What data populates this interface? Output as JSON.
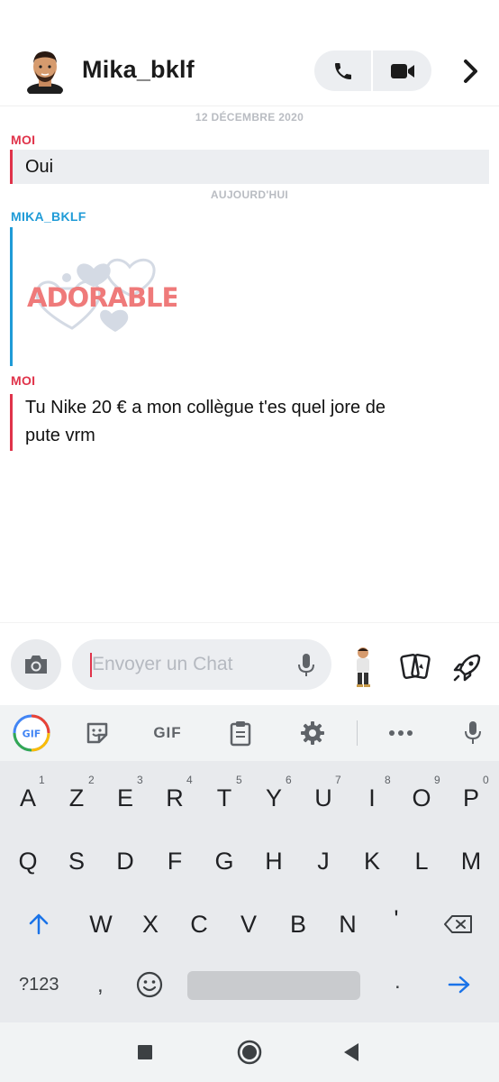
{
  "header": {
    "contact_name": "Mika_bklf",
    "avatar_icon": "bitmoji-avatar",
    "call_icon": "phone-icon",
    "video_icon": "video-camera-icon",
    "more_icon": "chevron-right-icon"
  },
  "conversation": {
    "date_1": "12 DÉCEMBRE 2020",
    "date_2": "AUJOURD'HUI",
    "messages": [
      {
        "sender": "MOI",
        "text": "Oui"
      },
      {
        "sender": "MIKA_BKLF",
        "sticker_text": "ADORABLE"
      },
      {
        "sender": "MOI",
        "text_line1": "Tu Nike 20 € a mon collègue t'es quel jore de",
        "text_line2": "pute vrm"
      }
    ],
    "colors": {
      "me": "#e0334a",
      "other": "#1f9bd7",
      "sticker": "#ef7a7a"
    }
  },
  "input_bar": {
    "placeholder": "Envoyer un Chat",
    "camera_icon": "camera-icon",
    "mic_icon": "microphone-icon",
    "bitmoji_icon": "bitmoji-icon",
    "cards_icon": "cards-icon",
    "rocket_icon": "rocket-icon"
  },
  "keyboard": {
    "toolbar": [
      "gif-search-icon",
      "sticker-icon",
      "GIF",
      "clipboard-icon",
      "gear-icon",
      "more-icon",
      "microphone-icon"
    ],
    "gif_label": "GIF",
    "gif_badge": "GIF",
    "row1": [
      "A",
      "Z",
      "E",
      "R",
      "T",
      "Y",
      "U",
      "I",
      "O",
      "P"
    ],
    "row1_hints": [
      "1",
      "2",
      "3",
      "4",
      "5",
      "6",
      "7",
      "8",
      "9",
      "0"
    ],
    "row2": [
      "Q",
      "S",
      "D",
      "F",
      "G",
      "H",
      "J",
      "K",
      "L",
      "M"
    ],
    "row3": [
      "W",
      "X",
      "C",
      "V",
      "B",
      "N",
      "'"
    ],
    "symbols_key": "?123",
    "comma_key": ",",
    "period_key": ".",
    "accent_color": "#1a73e8"
  },
  "navbar": [
    "recents-square-icon",
    "home-circle-icon",
    "back-triangle-icon"
  ]
}
